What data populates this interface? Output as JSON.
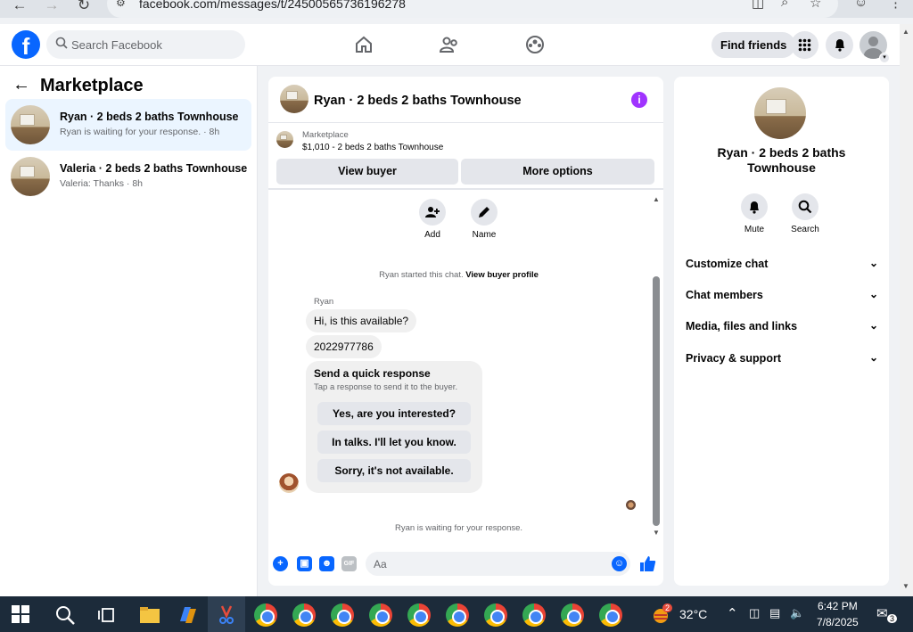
{
  "browser": {
    "url": "facebook.com/messages/t/24500565736196278"
  },
  "fb": {
    "search_placeholder": "Search Facebook",
    "find_friends": "Find friends"
  },
  "left": {
    "title": "Marketplace",
    "conversations": [
      {
        "name": "Ryan · 2 beds 2 baths Townhouse",
        "preview": "Ryan is waiting for your response. · 8h"
      },
      {
        "name": "Valeria · 2 beds 2 baths Townhouse",
        "preview": "Valeria: Thanks · 8h"
      }
    ]
  },
  "chat": {
    "title": "Ryan · 2 beds 2 baths Townhouse",
    "listing_label": "Marketplace",
    "listing_price": "$1,010 - 2 beds 2 baths Townhouse",
    "view_buyer": "View buyer",
    "more_options": "More options",
    "add_label": "Add",
    "name_label": "Name",
    "started_text": "Ryan started this chat. ",
    "view_profile": "View buyer profile",
    "sender": "Ryan",
    "messages": [
      "Hi, is this available?",
      "2022977786"
    ],
    "quick_title": "Send a quick response",
    "quick_sub": "Tap a response to send it to the buyer.",
    "quick_responses": [
      "Yes, are you interested?",
      "In talks. I'll let you know.",
      "Sorry, it's not available."
    ],
    "waiting": "Ryan is waiting for your response.",
    "composer_placeholder": "Aa"
  },
  "right": {
    "title": "Ryan · 2 beds 2 baths Townhouse",
    "mute": "Mute",
    "search": "Search",
    "sections": [
      "Customize chat",
      "Chat members",
      "Media, files and links",
      "Privacy & support"
    ]
  },
  "taskbar": {
    "temperature": "32°C",
    "time": "6:42 PM",
    "date": "7/8/2025",
    "notifications": "3",
    "weather_badge": "2"
  },
  "colors": {
    "accent": "#0866ff",
    "info": "#a033ff",
    "active_row": "#ebf5ff"
  }
}
